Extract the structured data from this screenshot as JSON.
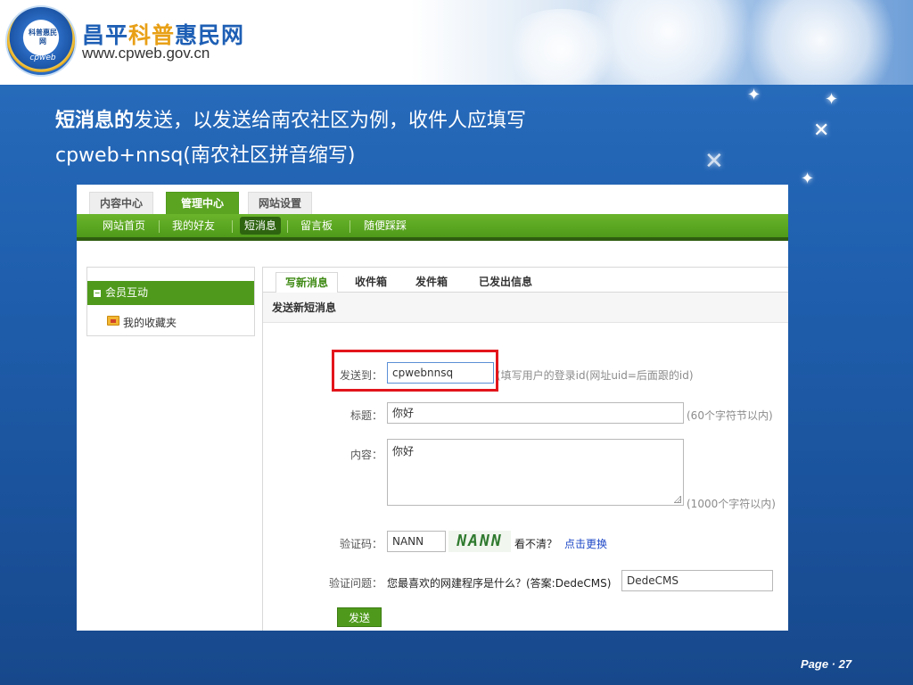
{
  "slide": {
    "site_title_part1": "昌平",
    "site_title_part2": "科普",
    "site_title_part3": "惠民网",
    "site_url": "www.cpweb.gov.cn",
    "logo_text": "科普惠民网",
    "logo_ring_text": "cpweb",
    "heading_line1_bold": "短消息的",
    "heading_line1_rest": "发送，以发送给南农社区为例，收件人应填写",
    "heading_line2": "cpweb+nnsq(南农社区拼音缩写)",
    "page_label": "Page · 27"
  },
  "app": {
    "top_tabs": [
      {
        "label": "内容中心",
        "active": false
      },
      {
        "label": "管理中心",
        "active": true
      },
      {
        "label": "网站设置",
        "active": false
      }
    ],
    "sub_nav": [
      {
        "label": "网站首页",
        "active": false
      },
      {
        "label": "我的好友",
        "active": false
      },
      {
        "label": "短消息",
        "active": true
      },
      {
        "label": "留言板",
        "active": false
      },
      {
        "label": "随便踩踩",
        "active": false
      }
    ],
    "sidebar": {
      "group_label": "会员互动",
      "favorites_label": "我的收藏夹"
    },
    "message_tabs": [
      {
        "label": "写新消息",
        "active": true
      },
      {
        "label": "收件箱",
        "active": false
      },
      {
        "label": "发件箱",
        "active": false
      },
      {
        "label": "已发出信息",
        "active": false
      }
    ],
    "section_title": "发送新短消息",
    "form": {
      "to_label": "发送到：",
      "to_value": "cpwebnnsq",
      "to_hint": "(填写用户的登录id(网址uid=后面跟的id)",
      "subject_label": "标题：",
      "subject_value": "你好",
      "subject_hint": "(60个字符节以内)",
      "content_label": "内容：",
      "content_value": "你好",
      "content_hint": "(1000个字符以内)",
      "captcha_label": "验证码：",
      "captcha_value": "NANN",
      "captcha_image_text": "NANN",
      "captcha_unclear": "看不清？",
      "captcha_refresh": "点击更换",
      "question_label": "验证问题：",
      "question_text": "您最喜欢的网建程序是什么？(答案:DedeCMS)",
      "question_value": "DedeCMS",
      "send_label": "发送"
    },
    "colors": {
      "nav_green": "#4f9a1c",
      "highlight_red": "#e3141b",
      "link_blue": "#1f49c7"
    }
  }
}
